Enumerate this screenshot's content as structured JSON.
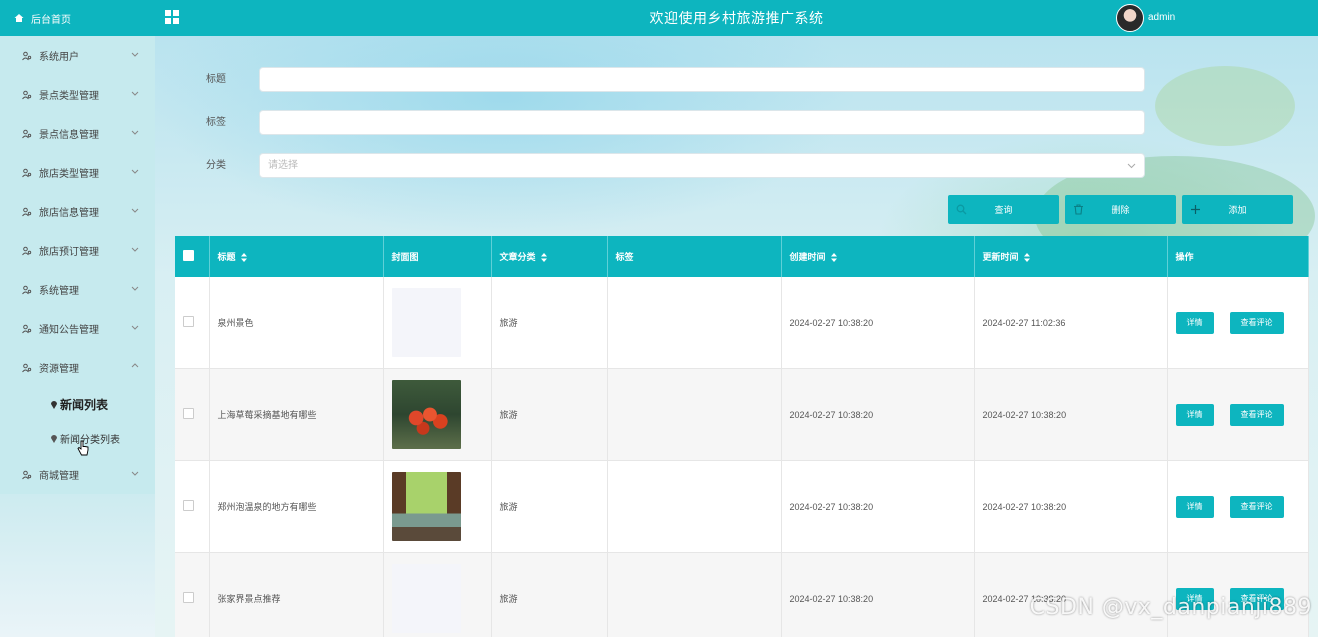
{
  "sidebar": {
    "home_label": "后台首页",
    "items": [
      {
        "label": "系统用户"
      },
      {
        "label": "景点类型管理"
      },
      {
        "label": "景点信息管理"
      },
      {
        "label": "旅店类型管理"
      },
      {
        "label": "旅店信息管理"
      },
      {
        "label": "旅店预订管理"
      },
      {
        "label": "系统管理"
      },
      {
        "label": "通知公告管理"
      },
      {
        "label": "资源管理"
      }
    ],
    "sub_items": [
      {
        "label": "新闻列表",
        "active": true
      },
      {
        "label": "新闻分类列表",
        "active": false
      }
    ],
    "last_item": {
      "label": "商城管理"
    }
  },
  "header": {
    "title": "欢迎使用乡村旅游推广系统",
    "username": "admin"
  },
  "search": {
    "title_label": "标题",
    "tag_label": "标签",
    "category_label": "分类",
    "category_placeholder": "请选择",
    "query_button": "查询",
    "delete_button": "删除",
    "add_button": "添加"
  },
  "table": {
    "columns": [
      "标题",
      "封面图",
      "文章分类",
      "标签",
      "创建时间",
      "更新时间",
      "操作"
    ],
    "detail_label": "详情",
    "comment_label": "查看评论",
    "rows": [
      {
        "title": "泉州景色",
        "category": "旅游",
        "tag": "",
        "created": "2024-02-27 10:38:20",
        "updated": "2024-02-27 11:02:36"
      },
      {
        "title": "上海草莓采摘基地有哪些",
        "category": "旅游",
        "tag": "",
        "created": "2024-02-27 10:38:20",
        "updated": "2024-02-27 10:38:20"
      },
      {
        "title": "郑州泡温泉的地方有哪些",
        "category": "旅游",
        "tag": "",
        "created": "2024-02-27 10:38:20",
        "updated": "2024-02-27 10:38:20"
      },
      {
        "title": "张家界景点推荐",
        "category": "旅游",
        "tag": "",
        "created": "2024-02-27 10:38:20",
        "updated": "2024-02-27 10:38:20"
      }
    ]
  },
  "watermark": "CSDN @vx_danpianji889",
  "colors": {
    "accent": "#0db5bf",
    "sidebar": "#c6eaee"
  }
}
